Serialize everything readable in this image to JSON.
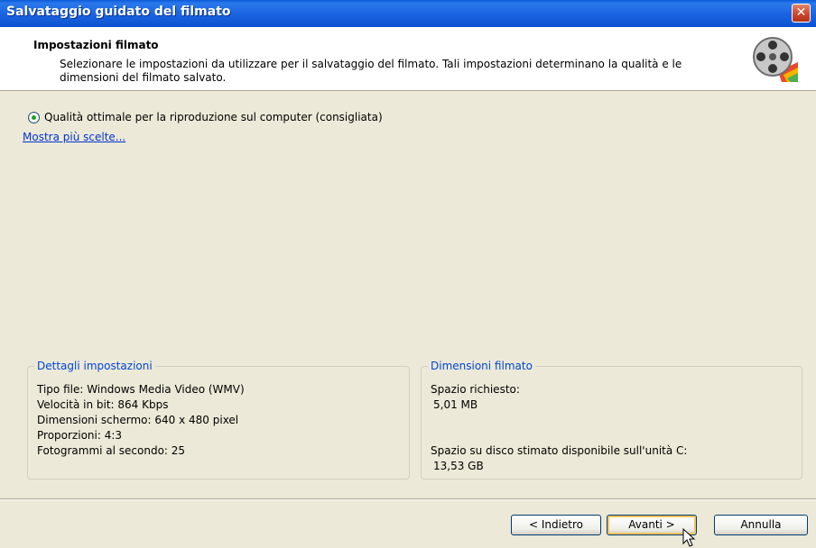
{
  "window": {
    "title": "Salvataggio guidato del filmato",
    "close_glyph": "✕"
  },
  "header": {
    "title": "Impostazioni filmato",
    "description": "Selezionare le impostazioni da utilizzare per il salvataggio del filmato. Tali impostazioni determinano la qualità e le dimensioni del filmato salvato.",
    "icon": "film-reel-icon"
  },
  "options": {
    "selected_label": "Qualità ottimale per la riproduzione sul computer (consigliata)",
    "more_link": "Mostra più scelte..."
  },
  "details": {
    "legend": "Dettagli impostazioni",
    "file_type": "Tipo file: Windows Media Video (WMV)",
    "bitrate": "Velocità in bit: 864 Kbps",
    "screen_size": "Dimensioni schermo: 640 x 480 pixel",
    "aspect": "Proporzioni: 4:3",
    "fps": "Fotogrammi al secondo: 25"
  },
  "size": {
    "legend": "Dimensioni filmato",
    "required_label": "Spazio richiesto:",
    "required_value": "5,01 MB",
    "available_label": "Spazio su disco stimato disponibile sull'unità C:",
    "available_value": "13,53 GB"
  },
  "buttons": {
    "back": "< Indietro",
    "next": "Avanti >",
    "cancel": "Annulla"
  },
  "colors": {
    "titlebar": "#0c52d0",
    "legend": "#0046d5",
    "link": "#0033cc",
    "default_button": "#f9c45b"
  }
}
